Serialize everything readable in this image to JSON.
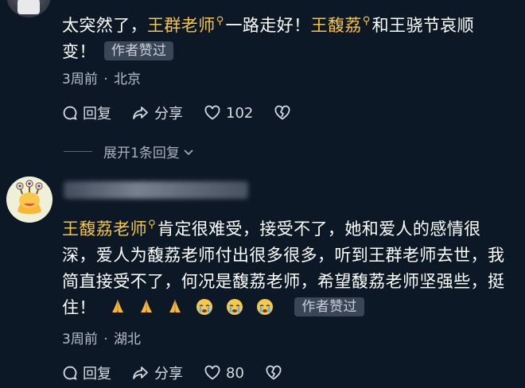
{
  "comment1": {
    "line1": {
      "prefix": "太突然了，",
      "mention1": "王群老师",
      "middle": "一路走好！",
      "mention2": "王馥荔",
      "suffix": "和王骁节哀顺"
    },
    "line2": "变！",
    "badge": "作者赞过",
    "time": "3周前",
    "separator": "·",
    "location": "北京",
    "reply_label": "回复",
    "share_label": "分享",
    "like_count": "102"
  },
  "expand_replies": "展开1条回复",
  "comment2": {
    "mention": "王馥荔老师",
    "line1_rest": "肯定很难受，接受不了，她和爱人的感情很",
    "line2": "深，爱人为馥荔老师付出很多很多，听到王群老师去世，我",
    "line3": "简直接受不了，何况是馥荔老师，希望馥荔老师坚强些，挺",
    "line4": "住！",
    "badge": "作者赞过",
    "time": "3周前",
    "separator": "·",
    "location": "湖北",
    "reply_label": "回复",
    "share_label": "分享",
    "like_count": "80"
  },
  "colors": {
    "background": "#0d1826",
    "mention": "#f5c543",
    "badge_bg": "#3a4556",
    "meta_text": "#b7bec8"
  },
  "icons": [
    "reply-icon",
    "share-icon",
    "heart-icon",
    "broken-heart-icon",
    "search-mention-icon",
    "pray-emoji",
    "crying-emoji",
    "chevron-down-icon"
  ]
}
